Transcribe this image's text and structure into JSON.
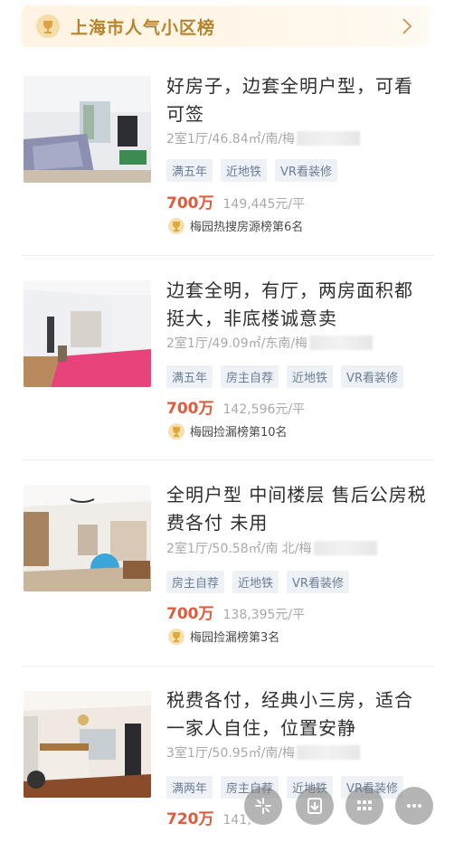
{
  "banner": {
    "title": "上海市人气小区榜"
  },
  "listings": [
    {
      "title": "好房子，边套全明户型，可看可签",
      "meta": "2室1厅/46.84㎡/南/梅",
      "tags": [
        "满五年",
        "近地铁",
        "VR看装修"
      ],
      "price": "700万",
      "unit_price": "149,445元/平",
      "badge": "梅园热搜房源榜第6名"
    },
    {
      "title": "边套全明，有厅，两房面积都挺大，非底楼诚意卖",
      "meta": "2室1厅/49.09㎡/东南/梅",
      "tags": [
        "满五年",
        "房主自荐",
        "近地铁",
        "VR看装修"
      ],
      "price": "700万",
      "unit_price": "142,596元/平",
      "badge": "梅园捡漏榜第10名"
    },
    {
      "title": "全明户型 中间楼层 售后公房税费各付 未用",
      "meta": "2室1厅/50.58㎡/南 北/梅",
      "tags": [
        "房主自荐",
        "近地铁",
        "VR看装修"
      ],
      "price": "700万",
      "unit_price": "138,395元/平",
      "badge": "梅园捡漏榜第3名"
    },
    {
      "title": "税费各付，经典小三房，适合一家人自住，位置安静",
      "meta": "3室1厅/50.95㎡/南/梅",
      "tags": [
        "满两年",
        "房主自荐",
        "近地铁",
        "VR看装修"
      ],
      "price": "720万",
      "unit_price": "141,",
      "badge": ""
    }
  ],
  "toolbar": [
    "sparkle-icon",
    "download-icon",
    "grid-icon",
    "more-icon"
  ],
  "colors": {
    "accent": "#e25a3a",
    "gold": "#b7832b",
    "tag_text": "#6b7d96",
    "tag_bg": "#eef1f6"
  }
}
